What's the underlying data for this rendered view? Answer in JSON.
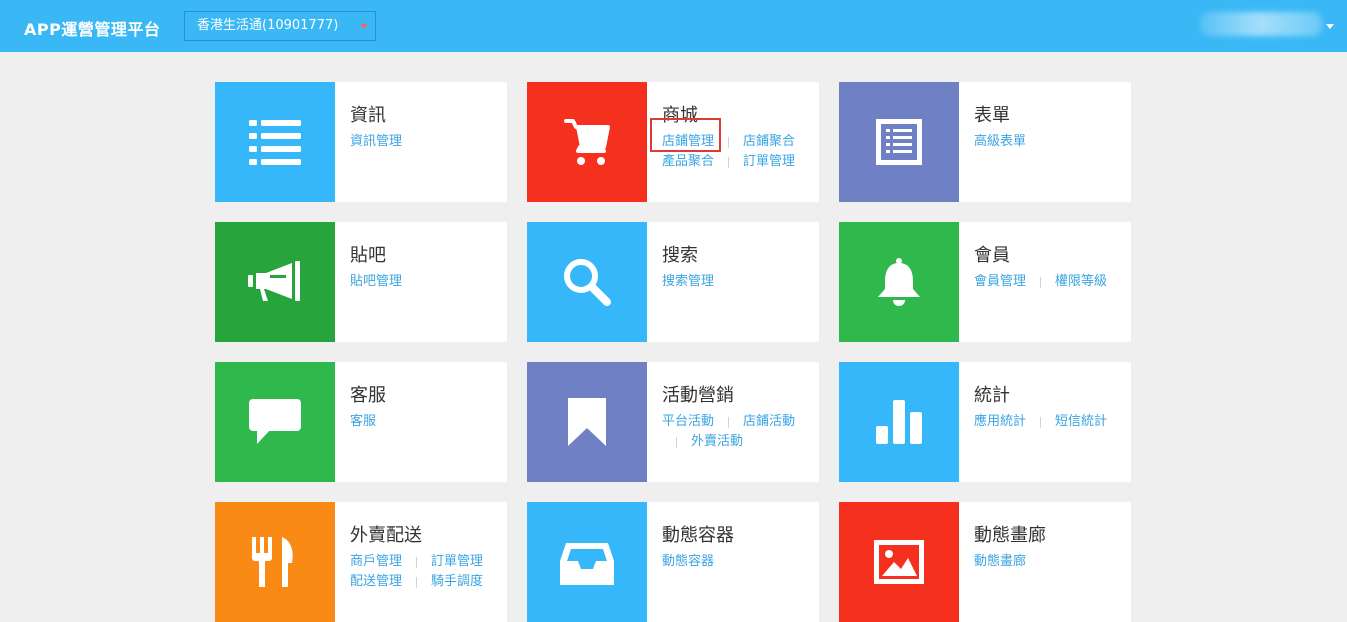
{
  "header": {
    "app_title": "APP運營管理平台",
    "store_select_value": "香港生活通(10901777)"
  },
  "colors": {
    "topbar": "#3ab8f5",
    "blue": "#35b7fa",
    "red": "#f5301f",
    "purple": "#7080c4",
    "green_dark": "#28a43c",
    "green": "#2fb84b",
    "orange": "#f98a16",
    "link": "#3aa4e3",
    "highlight": "#e03a36"
  },
  "modules": [
    {
      "title": "資訊",
      "icon": "list-icon",
      "links": [
        [
          "資訊管理"
        ]
      ]
    },
    {
      "title": "商城",
      "icon": "cart-icon",
      "links": [
        [
          "店鋪管理",
          "店鋪聚合"
        ],
        [
          "產品聚合",
          "訂單管理"
        ]
      ]
    },
    {
      "title": "表單",
      "icon": "form-icon",
      "links": [
        [
          "高級表單"
        ]
      ]
    },
    {
      "title": "貼吧",
      "icon": "megaphone-icon",
      "links": [
        [
          "貼吧管理"
        ]
      ]
    },
    {
      "title": "搜索",
      "icon": "search-icon",
      "links": [
        [
          "搜索管理"
        ]
      ]
    },
    {
      "title": "會員",
      "icon": "bell-icon",
      "links": [
        [
          "會員管理",
          "權限等級"
        ]
      ]
    },
    {
      "title": "客服",
      "icon": "chat-icon",
      "links": [
        [
          "客服"
        ]
      ]
    },
    {
      "title": "活動營銷",
      "icon": "bookmark-icon",
      "links": [
        [
          "平台活動",
          "店鋪活動"
        ],
        [
          "",
          "外賣活動"
        ]
      ]
    },
    {
      "title": "統計",
      "icon": "bar-chart-icon",
      "links": [
        [
          "應用統計",
          "短信統計"
        ]
      ]
    },
    {
      "title": "外賣配送",
      "icon": "cutlery-icon",
      "links": [
        [
          "商戶管理",
          "訂單管理"
        ],
        [
          "配送管理",
          "騎手調度"
        ]
      ]
    },
    {
      "title": "動態容器",
      "icon": "inbox-icon",
      "links": [
        [
          "動態容器"
        ]
      ]
    },
    {
      "title": "動態畫廊",
      "icon": "picture-icon",
      "links": [
        [
          "動態畫廊"
        ]
      ]
    }
  ]
}
